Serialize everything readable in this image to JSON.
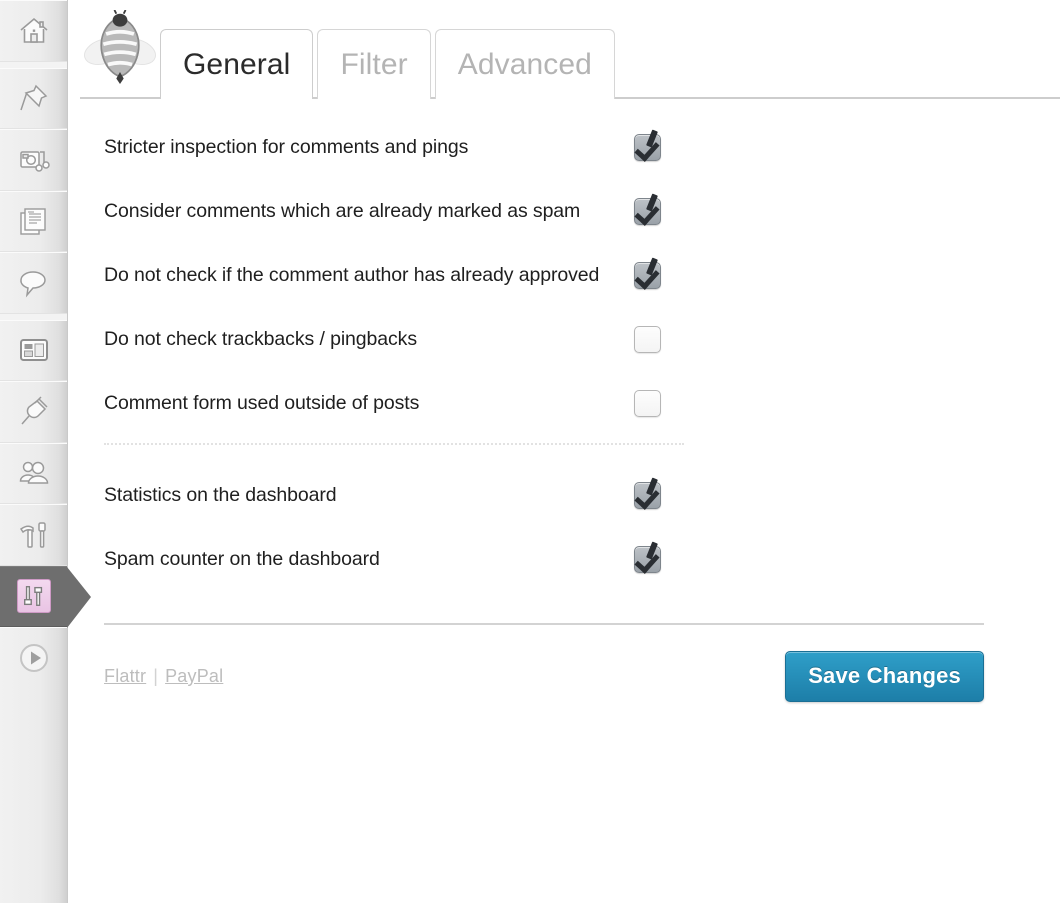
{
  "sidebar": {
    "items": [
      {
        "name": "dashboard",
        "icon": "home-icon",
        "active": false
      },
      {
        "name": "posts",
        "icon": "pin-icon",
        "active": false
      },
      {
        "name": "media",
        "icon": "media-icon",
        "active": false
      },
      {
        "name": "pages",
        "icon": "pages-icon",
        "active": false
      },
      {
        "name": "comments",
        "icon": "comment-bubble-icon",
        "active": false
      },
      {
        "name": "appearance",
        "icon": "layout-icon",
        "active": false
      },
      {
        "name": "plugins",
        "icon": "plug-icon",
        "active": false
      },
      {
        "name": "users",
        "icon": "users-icon",
        "active": false
      },
      {
        "name": "tools",
        "icon": "hammer-wrench-icon",
        "active": false
      },
      {
        "name": "settings",
        "icon": "sliders-icon",
        "active": true
      },
      {
        "name": "collapse",
        "icon": "play-circle-icon",
        "active": false
      }
    ]
  },
  "header": {
    "logo_icon": "antispam-bee-icon",
    "tabs": [
      {
        "id": "general",
        "label": "General",
        "active": true
      },
      {
        "id": "filter",
        "label": "Filter",
        "active": false
      },
      {
        "id": "advanced",
        "label": "Advanced",
        "active": false
      }
    ]
  },
  "settings": {
    "group_main": [
      {
        "id": "stricter-inspection",
        "label": "Stricter inspection for comments and pings",
        "checked": true
      },
      {
        "id": "consider-spam-marked",
        "label": "Consider comments which are already marked as spam",
        "checked": true
      },
      {
        "id": "skip-approved-author",
        "label": "Do not check if the comment author has already approved",
        "checked": true
      },
      {
        "id": "skip-trackbacks",
        "label": "Do not check trackbacks / pingbacks",
        "checked": false
      },
      {
        "id": "comment-form-outside-posts",
        "label": "Comment form used outside of posts",
        "checked": false
      }
    ],
    "group_dashboard": [
      {
        "id": "statistics-dashboard",
        "label": "Statistics on the dashboard",
        "checked": true
      },
      {
        "id": "spam-counter-dashboard",
        "label": "Spam counter on the dashboard",
        "checked": true
      }
    ]
  },
  "footer": {
    "links": [
      {
        "id": "flattr",
        "label": "Flattr"
      },
      {
        "id": "paypal",
        "label": "PayPal"
      }
    ],
    "link_separator": "|",
    "save_label": "Save Changes"
  },
  "colors": {
    "accent_blue": "#2f9fc9",
    "accent_blue_dark": "#1d7ea8",
    "active_sidebar_bg": "#6e6e6e",
    "active_icon_pink": "#e9c4e4",
    "tab_inactive_text": "#b4b4b4",
    "tab_active_text": "#2b2b2b",
    "link_gray": "#bdbdbd"
  }
}
